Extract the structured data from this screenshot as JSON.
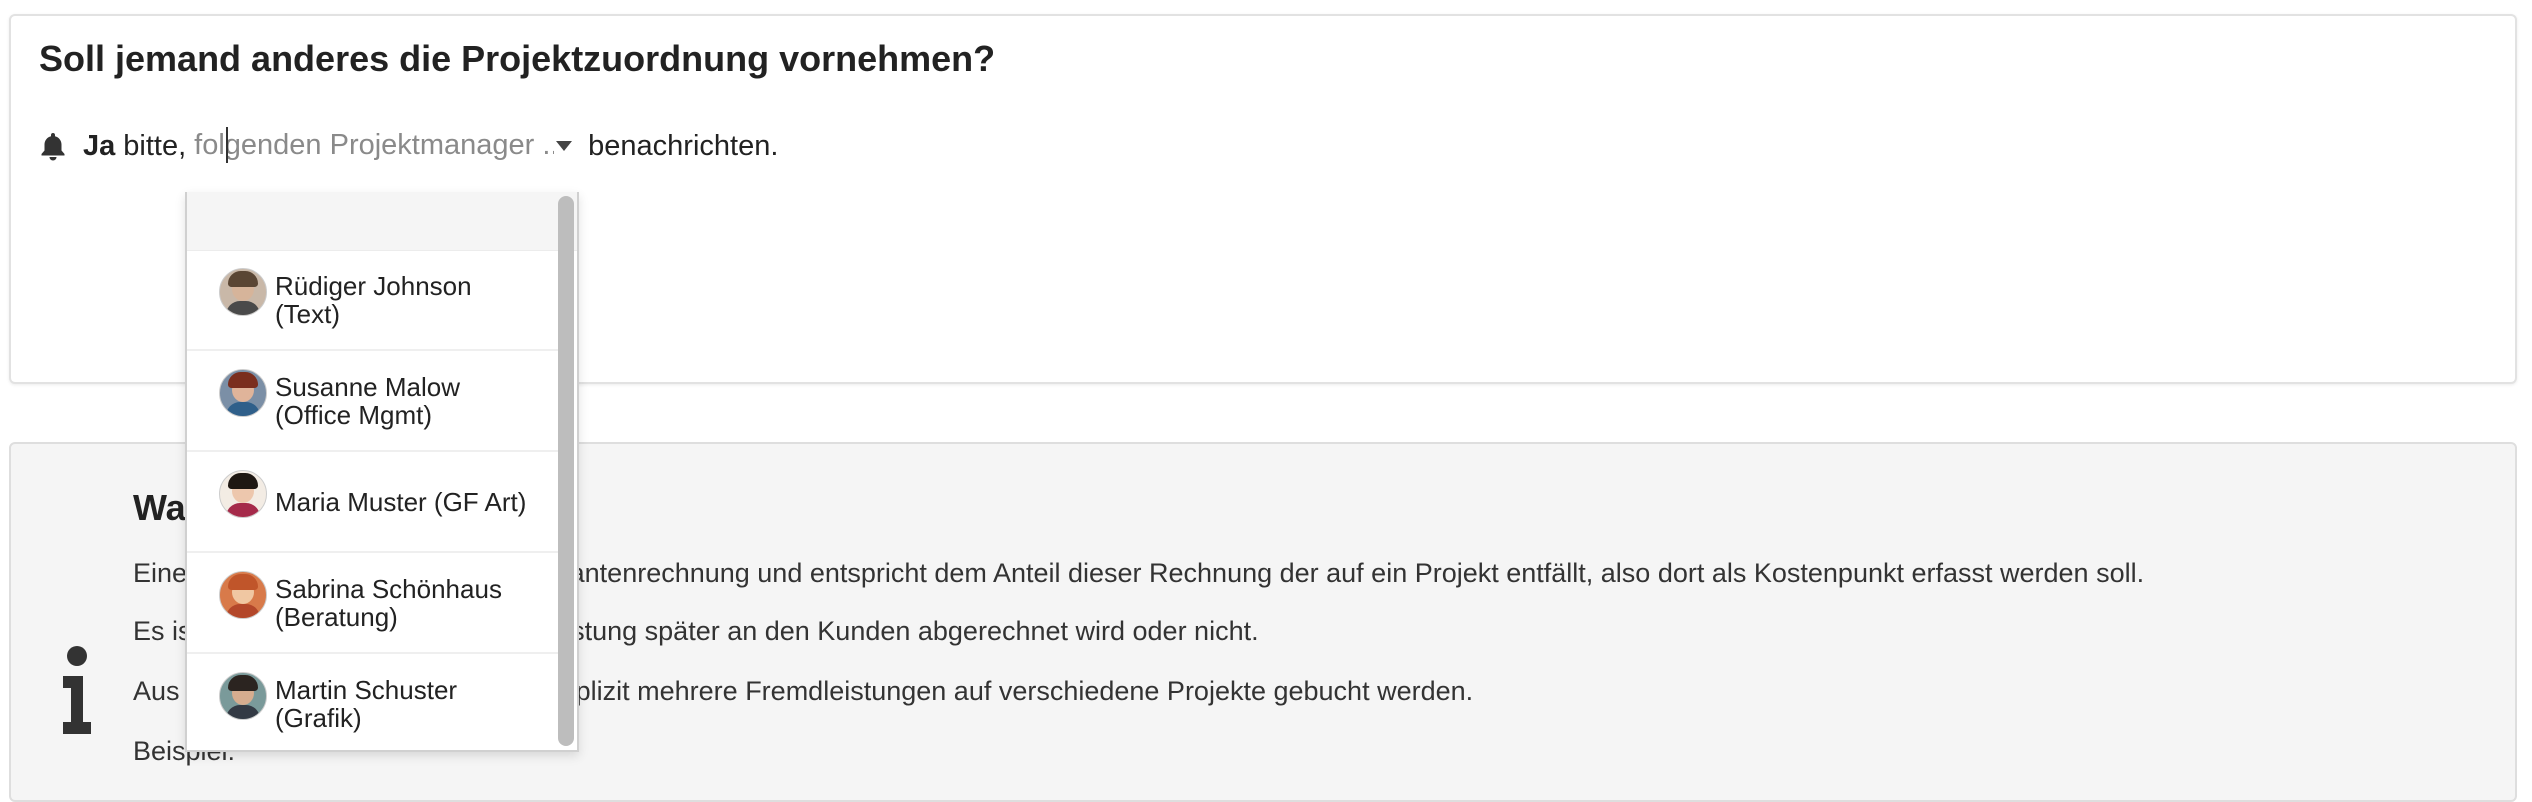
{
  "assignment": {
    "title": "Soll jemand anderes die Projektzuordnung vornehmen?",
    "yes_label": "Ja",
    "please_text": "bitte,",
    "select_placeholder": "folgenden Projektmanager ...",
    "after_text": "benachrichten."
  },
  "dropdown": {
    "options": [
      {
        "name": "Rüdiger Johnson (Text)",
        "avatar_colors": {
          "bg": "#c9b8a8",
          "hair": "#5a4634",
          "face": "#d6b49a",
          "body": "#4a4a4a"
        }
      },
      {
        "name": "Susanne Malow (Office Mgmt)",
        "avatar_colors": {
          "bg": "#7b8fa6",
          "hair": "#7a2e1e",
          "face": "#e0b49a",
          "body": "#2f5f8a"
        }
      },
      {
        "name": "Maria Muster (GF Art)",
        "avatar_colors": {
          "bg": "#f3ece4",
          "hair": "#1e1712",
          "face": "#edc7ad",
          "body": "#a52a4a"
        }
      },
      {
        "name": "Sabrina Schönhaus (Beratung)",
        "avatar_colors": {
          "bg": "#d87a4a",
          "hair": "#c0552a",
          "face": "#f0c7a2",
          "body": "#b3472a"
        }
      },
      {
        "name": "Martin Schuster (Grafik)",
        "avatar_colors": {
          "bg": "#7a9a9a",
          "hair": "#2b2420",
          "face": "#d6ad8f",
          "body": "#333a44"
        }
      }
    ]
  },
  "info": {
    "heading": "Wa",
    "lines": [
      "Eine                                          Lieferantenrechnung und entspricht dem Anteil dieser Rechnung der auf ein Projekt entfällt, also dort als Kostenpunkt erfasst werden soll.",
      "Es is                                          ie Leistung später an den Kunden abgerechnet wird oder nicht.",
      "Aus                                            en explizit mehrere Fremdleistungen auf verschiedene Projekte gebucht werden.",
      "Beispiel:"
    ]
  }
}
